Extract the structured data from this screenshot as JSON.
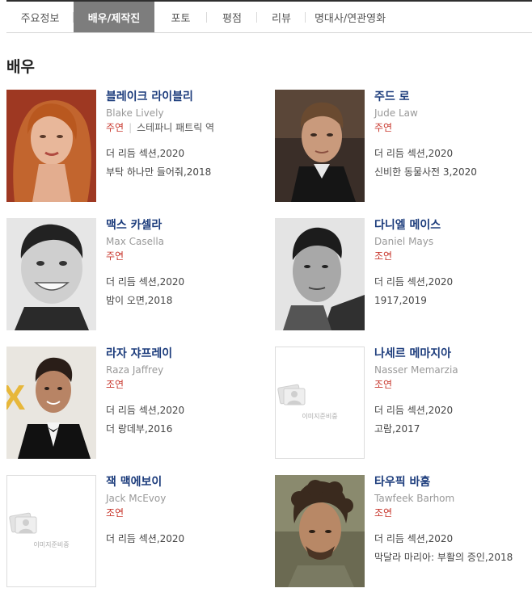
{
  "tabs": [
    {
      "label": "주요정보",
      "active": false
    },
    {
      "label": "배우/제작진",
      "active": true
    },
    {
      "label": "포토",
      "active": false
    },
    {
      "label": "평점",
      "active": false
    },
    {
      "label": "리뷰",
      "active": false
    },
    {
      "label": "명대사/연관영화",
      "active": false
    }
  ],
  "section_title": "배우",
  "placeholder_text": "이미지준비중",
  "actors": [
    {
      "name": "블레이크 라이블리",
      "english_name": "Blake Lively",
      "role": "주연",
      "character": "스테파니 패트릭 역",
      "films": [
        "더 리듬 섹션,2020",
        "부탁 하나만 들어줘,2018"
      ],
      "has_photo": true
    },
    {
      "name": "주드 로",
      "english_name": "Jude Law",
      "role": "주연",
      "character": "",
      "films": [
        "더 리듬 섹션,2020",
        "신비한 동물사전 3,2020"
      ],
      "has_photo": true
    },
    {
      "name": "맥스 카셀라",
      "english_name": "Max Casella",
      "role": "주연",
      "character": "",
      "films": [
        "더 리듬 섹션,2020",
        "밤이 오면,2018"
      ],
      "has_photo": true
    },
    {
      "name": "다니엘 메이스",
      "english_name": "Daniel Mays",
      "role": "조연",
      "character": "",
      "films": [
        "더 리듬 섹션,2020",
        "1917,2019"
      ],
      "has_photo": true
    },
    {
      "name": "라자 쟈프레이",
      "english_name": "Raza Jaffrey",
      "role": "조연",
      "character": "",
      "films": [
        "더 리듬 섹션,2020",
        "더 랑데부,2016"
      ],
      "has_photo": true
    },
    {
      "name": "나세르 메마지아",
      "english_name": "Nasser Memarzia",
      "role": "조연",
      "character": "",
      "films": [
        "더 리듬 섹션,2020",
        "고람,2017"
      ],
      "has_photo": false
    },
    {
      "name": "잭 맥에보이",
      "english_name": "Jack McEvoy",
      "role": "조연",
      "character": "",
      "films": [
        "더 리듬 섹션,2020"
      ],
      "has_photo": false
    },
    {
      "name": "타우픽 바훔",
      "english_name": "Tawfeek Barhom",
      "role": "조연",
      "character": "",
      "films": [
        "더 리듬 섹션,2020",
        "막달라 마리아: 부활의 증인,2018"
      ],
      "has_photo": true
    }
  ]
}
